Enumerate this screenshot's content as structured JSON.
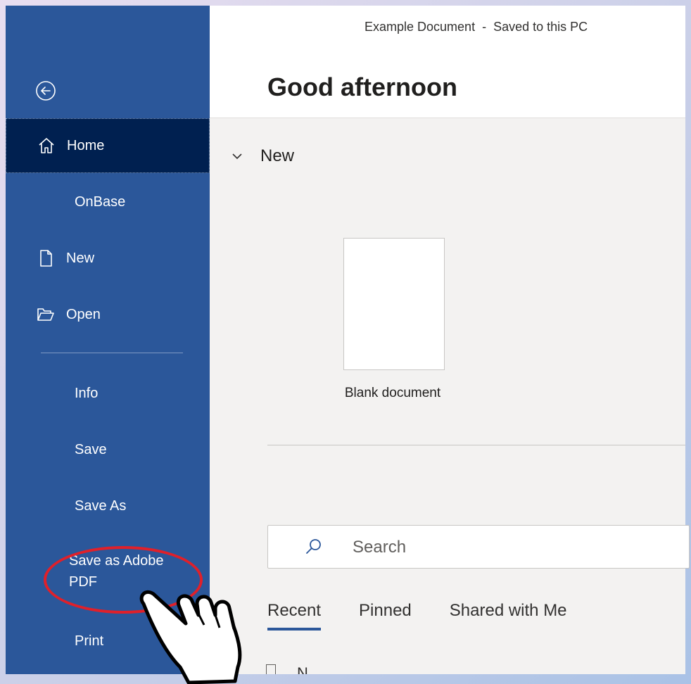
{
  "window": {
    "status": "Example Document  -  Saved to this PC"
  },
  "sidebar": {
    "items": [
      {
        "id": "home",
        "label": "Home",
        "icon": "home-icon"
      },
      {
        "id": "onbase",
        "label": "OnBase"
      },
      {
        "id": "new",
        "label": "New",
        "icon": "page-icon"
      },
      {
        "id": "open",
        "label": "Open",
        "icon": "folder-open-icon"
      },
      {
        "id": "info",
        "label": "Info"
      },
      {
        "id": "save",
        "label": "Save"
      },
      {
        "id": "save-as",
        "label": "Save As"
      },
      {
        "id": "save-as-adobe-pdf",
        "label_line1": "Save as Adobe",
        "label_line2": "PDF"
      },
      {
        "id": "print",
        "label": "Print"
      }
    ],
    "back_icon": "back-arrow-circle-icon"
  },
  "main": {
    "greeting": "Good afternoon",
    "section_new": {
      "title": "New",
      "templates": [
        {
          "label": "Blank document"
        }
      ]
    },
    "search": {
      "placeholder": "Search"
    },
    "tabs": [
      {
        "label": "Recent",
        "active": true
      },
      {
        "label": "Pinned",
        "active": false
      },
      {
        "label": "Shared with Me",
        "active": false
      }
    ],
    "list_partial_text": "N"
  },
  "colors": {
    "sidebar": "#2b579a",
    "sidebar_selected": "#002050",
    "highlight_ring": "#e0202a",
    "active_tab_underline": "#2b579a"
  }
}
